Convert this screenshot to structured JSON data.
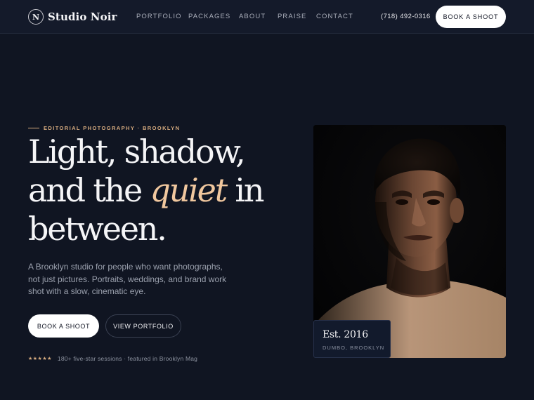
{
  "brand": {
    "mark": "N",
    "name": "Studio Noir"
  },
  "nav": {
    "items": [
      {
        "label": "PORTFOLIO"
      },
      {
        "label": "PACKAGES"
      },
      {
        "label": "ABOUT"
      },
      {
        "label": "PRAISE"
      },
      {
        "label": "CONTACT"
      }
    ],
    "phone": "(718) 492-0316",
    "cta_label": "BOOK A SHOOT"
  },
  "hero": {
    "eyebrow": "EDITORIAL PHOTOGRAPHY · BROOKLYN",
    "headline": {
      "line1": "Light, shadow,",
      "line2_before": "and the ",
      "line2_accent": "quiet",
      "line2_after": " in",
      "line3": "between."
    },
    "lede": "A Brooklyn studio for people who want photographs, not just pictures. Portraits, weddings, and brand work shot with a slow, cinematic eye.",
    "primary_cta": "BOOK A SHOOT",
    "secondary_cta": "VIEW PORTFOLIO",
    "rating_stars": "★★★★★",
    "social_proof": "180+ five-star sessions · featured in Brooklyn Mag"
  },
  "photo": {
    "subject": "portrait-photo",
    "badge_title": "Est. 2016",
    "badge_subtitle": "DUMBO, BROOKLYN"
  },
  "colors": {
    "background": "#101522",
    "header": "#141a2a",
    "accent": "#d9ad80",
    "accent_light": "#f0c79e",
    "button": "#ffffff"
  }
}
